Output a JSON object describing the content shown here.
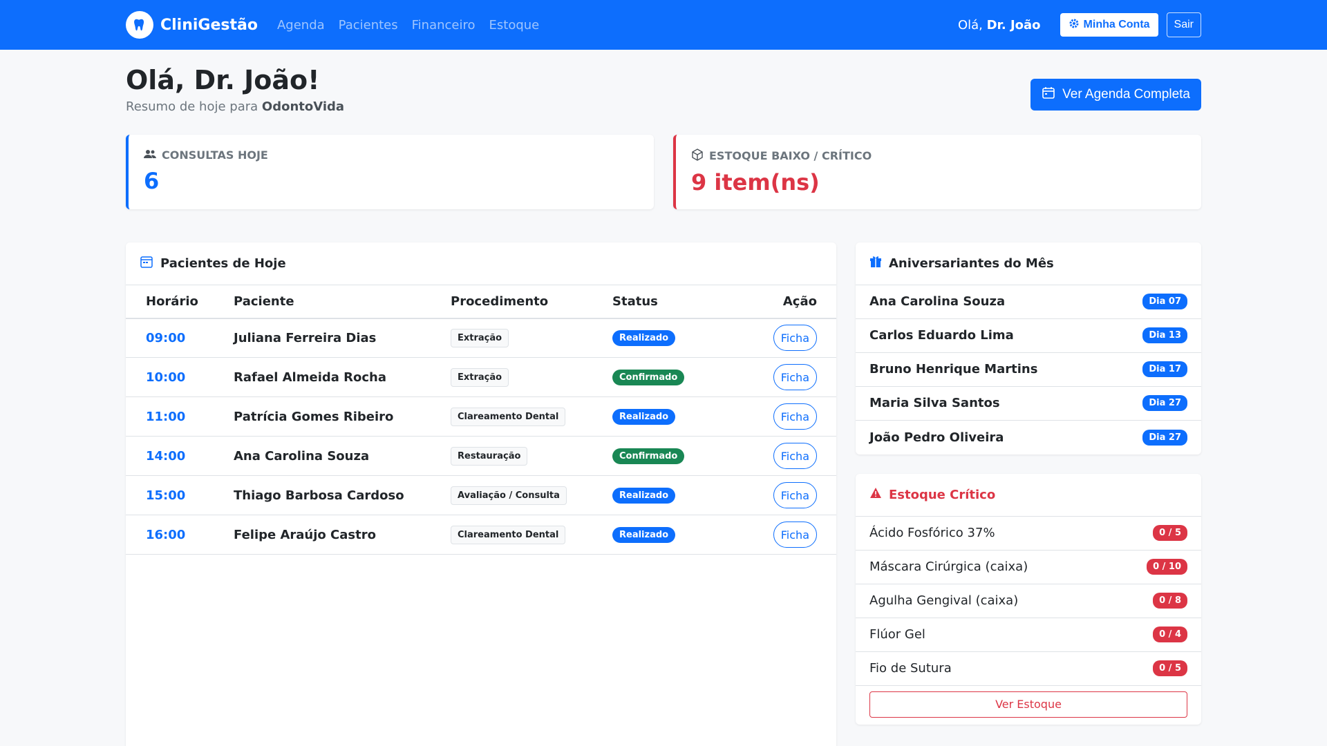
{
  "nav": {
    "brand": "CliniGestão",
    "links": [
      "Agenda",
      "Pacientes",
      "Financeiro",
      "Estoque"
    ],
    "greeting_prefix": "Olá,",
    "greeting_name": "Dr. João",
    "account_label": "Minha Conta",
    "logout_label": "Sair"
  },
  "header": {
    "title": "Olá, Dr. João!",
    "subtitle_prefix": "Resumo de hoje para",
    "clinic": "OdontoVida",
    "agenda_button": "Ver Agenda Completa"
  },
  "stats": {
    "consultas_label": "CONSULTAS HOJE",
    "consultas_value": "6",
    "estoque_label": "ESTOQUE BAIXO / CRÍTICO",
    "estoque_value": "9 item(ns)"
  },
  "patients": {
    "title": "Pacientes de Hoje",
    "columns": [
      "Horário",
      "Paciente",
      "Procedimento",
      "Status",
      "Ação"
    ],
    "rows": [
      {
        "time": "09:00",
        "name": "Juliana Ferreira Dias",
        "procedure": "Extração",
        "status": "Realizado",
        "action": "Ficha"
      },
      {
        "time": "10:00",
        "name": "Rafael Almeida Rocha",
        "procedure": "Extração",
        "status": "Confirmado",
        "action": "Ficha"
      },
      {
        "time": "11:00",
        "name": "Patrícia Gomes Ribeiro",
        "procedure": "Clareamento Dental",
        "status": "Realizado",
        "action": "Ficha"
      },
      {
        "time": "14:00",
        "name": "Ana Carolina Souza",
        "procedure": "Restauração",
        "status": "Confirmado",
        "action": "Ficha"
      },
      {
        "time": "15:00",
        "name": "Thiago Barbosa Cardoso",
        "procedure": "Avaliação / Consulta",
        "status": "Realizado",
        "action": "Ficha"
      },
      {
        "time": "16:00",
        "name": "Felipe Araújo Castro",
        "procedure": "Clareamento Dental",
        "status": "Realizado",
        "action": "Ficha"
      }
    ]
  },
  "birthdays": {
    "title": "Aniversariantes do Mês",
    "items": [
      {
        "name": "Ana Carolina Souza",
        "day": "Dia 07"
      },
      {
        "name": "Carlos Eduardo Lima",
        "day": "Dia 13"
      },
      {
        "name": "Bruno Henrique Martins",
        "day": "Dia 17"
      },
      {
        "name": "Maria Silva Santos",
        "day": "Dia 27"
      },
      {
        "name": "João Pedro Oliveira",
        "day": "Dia 27"
      }
    ]
  },
  "critical_stock": {
    "title": "Estoque Crítico",
    "items": [
      {
        "name": "Ácido Fosfórico 37%",
        "qty": "0 / 5"
      },
      {
        "name": "Máscara Cirúrgica (caixa)",
        "qty": "0 / 10"
      },
      {
        "name": "Agulha Gengival (caixa)",
        "qty": "0 / 8"
      },
      {
        "name": "Flúor Gel",
        "qty": "0 / 4"
      },
      {
        "name": "Fio de Sutura",
        "qty": "0 / 5"
      }
    ],
    "button": "Ver Estoque"
  },
  "colors": {
    "primary": "#0d6efd",
    "danger": "#dc3545",
    "success": "#198754",
    "status_realizado": "#0d6efd",
    "status_confirmado": "#198754"
  },
  "icons": [
    "tooth-icon",
    "gear-icon",
    "calendar-icon",
    "users-icon",
    "box-icon",
    "gift-icon",
    "warning-icon"
  ]
}
